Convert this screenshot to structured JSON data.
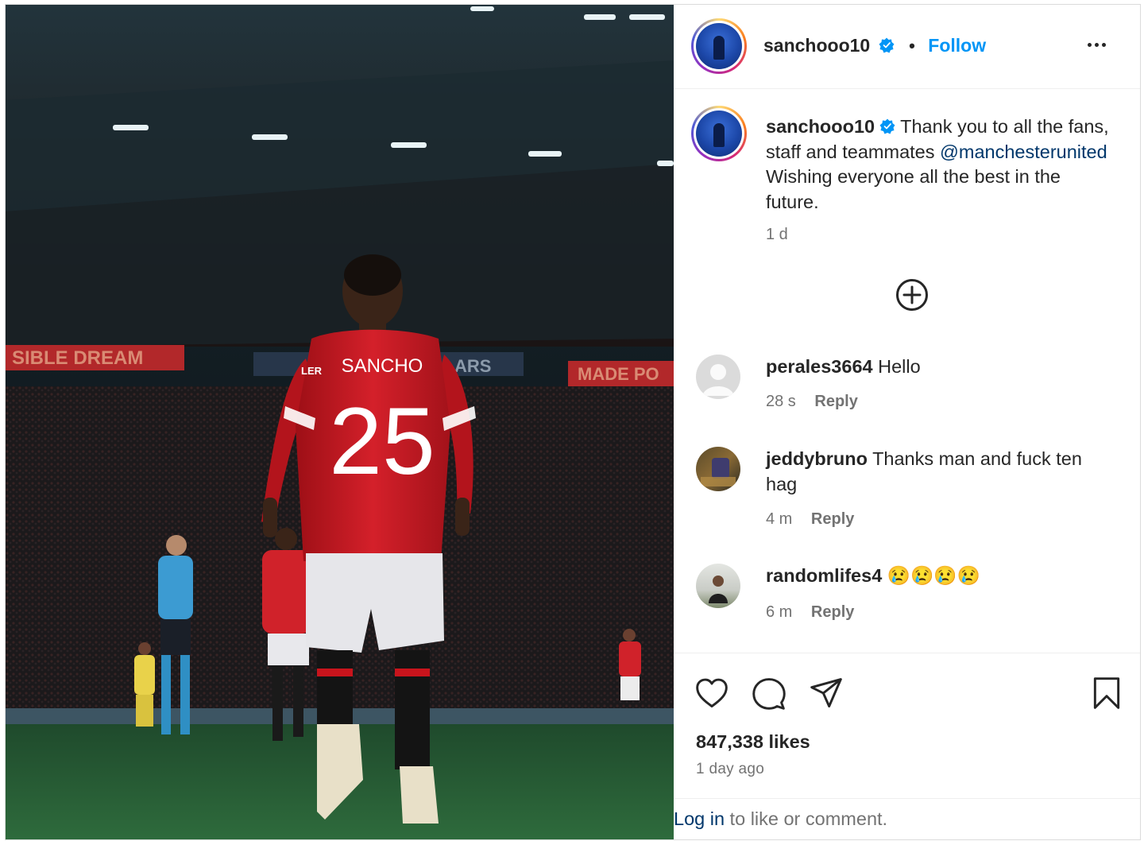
{
  "post": {
    "author": {
      "username": "sanchooo10",
      "avatar_icon": "profile-avatar-icon",
      "verified_icon": "verified-badge-icon"
    },
    "follow_label": "Follow",
    "separator": "•",
    "more_icon": "more-options-icon",
    "photo": {
      "jersey_name": "SANCHO",
      "jersey_number": "25",
      "banner_left": "SIBLE DREAM",
      "banner_right": "MADE PO",
      "banner_mid": "ARS",
      "banner_sponsor": "LER"
    },
    "caption": {
      "username": "sanchooo10",
      "text_part1": "Thank you to all the fans, staff and teammates",
      "mention": "@manchesterunited",
      "text_part2": "Wishing everyone all the best in the future.",
      "time": "1 d"
    },
    "load_more_icon": "plus-circle-icon",
    "comments": [
      {
        "username": "perales3664",
        "text": "Hello",
        "time": "28 s",
        "reply_label": "Reply",
        "avatar": "default-avatar-icon"
      },
      {
        "username": "jeddybruno",
        "text": "Thanks man and fuck ten hag",
        "time": "4 m",
        "reply_label": "Reply",
        "avatar": "user-photo-avatar"
      },
      {
        "username": "randomlifes4",
        "text": "😢😢😢😢",
        "time": "6 m",
        "reply_label": "Reply",
        "avatar": "user-photo-avatar"
      }
    ],
    "actions": {
      "like_icon": "heart-icon",
      "comment_icon": "comment-icon",
      "share_icon": "share-icon",
      "save_icon": "bookmark-icon"
    },
    "likes_text": "847,338 likes",
    "posted_ago": "1 day ago",
    "login_prompt": {
      "link": "Log in",
      "text": " to like or comment."
    }
  },
  "colors": {
    "link_blue": "#0095f6",
    "mention_blue": "#00376b",
    "text": "#262626",
    "muted": "#737373"
  }
}
